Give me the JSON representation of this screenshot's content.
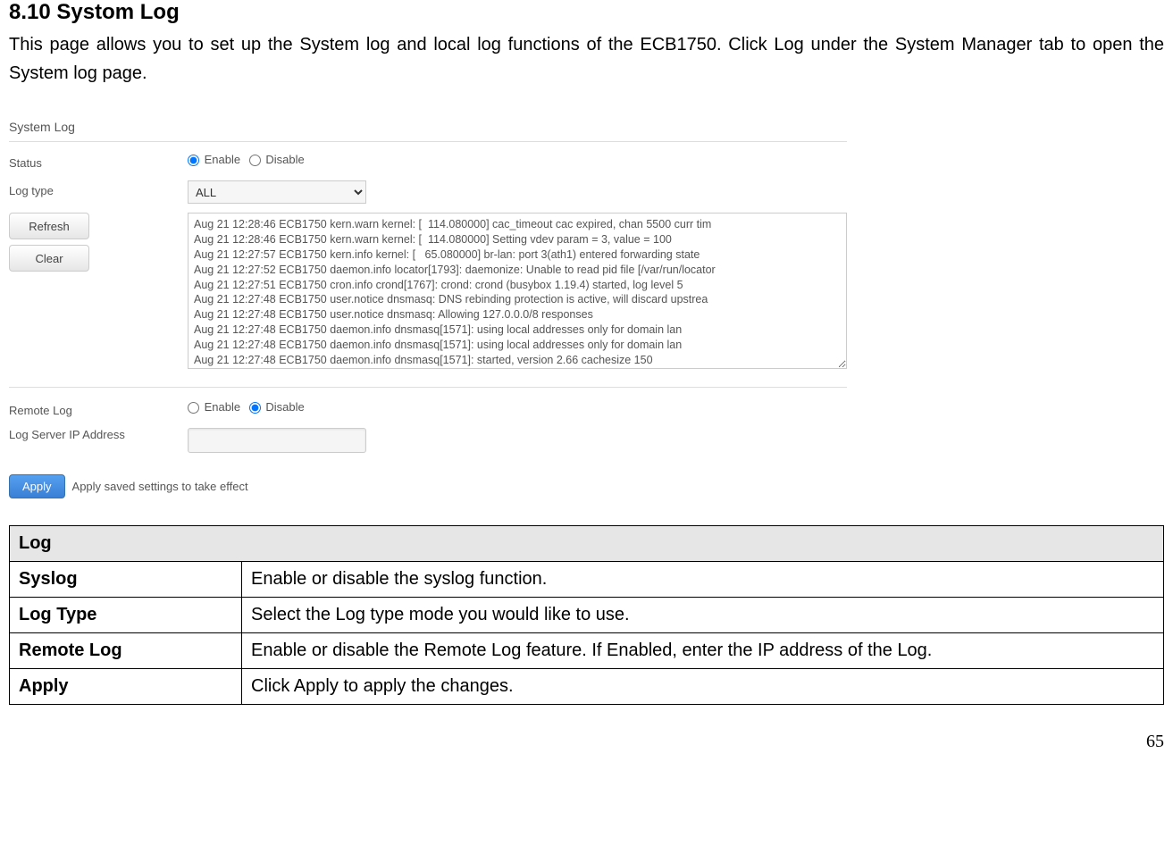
{
  "section": {
    "title": "8.10 Systom Log",
    "intro": "This page allows you to set up the System log and local log functions of the ECB1750. Click Log under the System Manager tab to open the System log page."
  },
  "screenshot": {
    "panel_title": "System Log",
    "status_label": "Status",
    "status_enable": "Enable",
    "status_disable": "Disable",
    "logtype_label": "Log type",
    "logtype_value": "ALL",
    "refresh_btn": "Refresh",
    "clear_btn": "Clear",
    "log_content": "Aug 21 12:28:46 ECB1750 kern.warn kernel: [  114.080000] cac_timeout cac expired, chan 5500 curr tim\nAug 21 12:28:46 ECB1750 kern.warn kernel: [  114.080000] Setting vdev param = 3, value = 100\nAug 21 12:27:57 ECB1750 kern.info kernel: [   65.080000] br-lan: port 3(ath1) entered forwarding state\nAug 21 12:27:52 ECB1750 daemon.info locator[1793]: daemonize: Unable to read pid file [/var/run/locator\nAug 21 12:27:51 ECB1750 cron.info crond[1767]: crond: crond (busybox 1.19.4) started, log level 5\nAug 21 12:27:48 ECB1750 user.notice dnsmasq: DNS rebinding protection is active, will discard upstrea\nAug 21 12:27:48 ECB1750 user.notice dnsmasq: Allowing 127.0.0.0/8 responses\nAug 21 12:27:48 ECB1750 daemon.info dnsmasq[1571]: using local addresses only for domain lan\nAug 21 12:27:48 ECB1750 daemon.info dnsmasq[1571]: using local addresses only for domain lan\nAug 21 12:27:48 ECB1750 daemon.info dnsmasq[1571]: started, version 2.66 cachesize 150",
    "remote_log_label": "Remote Log",
    "remote_enable": "Enable",
    "remote_disable": "Disable",
    "log_server_ip_label": "Log Server IP Address",
    "log_server_ip_value": "",
    "apply_btn": "Apply",
    "apply_hint": "Apply saved settings to take effect"
  },
  "desc_table": {
    "header": "Log",
    "rows": [
      {
        "key": "Syslog",
        "val": "Enable or disable the syslog function."
      },
      {
        "key": "Log Type",
        "val": "Select the Log type mode you would like to use."
      },
      {
        "key": "Remote Log",
        "val": "Enable or disable the Remote Log feature. If Enabled, enter the IP address of the Log."
      },
      {
        "key": "Apply",
        "val": "Click Apply to apply the changes."
      }
    ]
  },
  "page_number": "65"
}
